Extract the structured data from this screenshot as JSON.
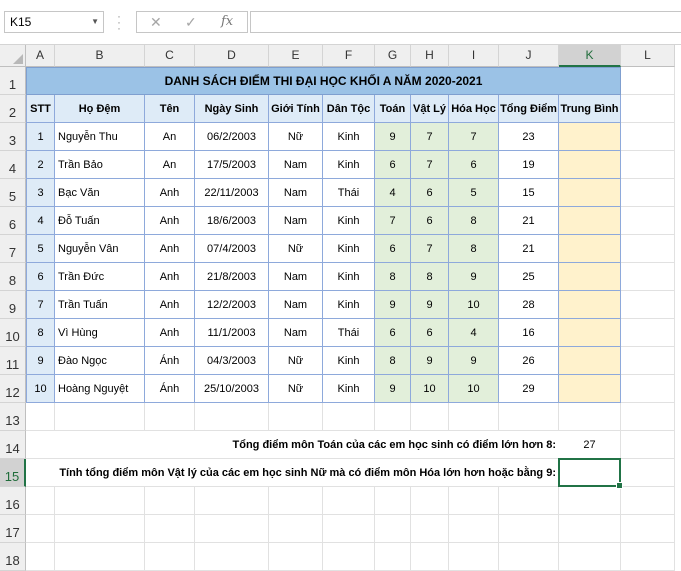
{
  "formula_bar": {
    "name_box": "K15",
    "cancel_icon": "✕",
    "enter_icon": "✓",
    "fx_label": "fx",
    "formula": ""
  },
  "columns": [
    "A",
    "B",
    "C",
    "D",
    "E",
    "F",
    "G",
    "H",
    "I",
    "J",
    "K",
    "L"
  ],
  "rows": [
    "1",
    "2",
    "3",
    "4",
    "5",
    "6",
    "7",
    "8",
    "9",
    "10",
    "11",
    "12",
    "13",
    "14",
    "15",
    "16",
    "17",
    "18"
  ],
  "sheet": {
    "title": "DANH SÁCH ĐIỂM THI ĐẠI HỌC KHỐI A NĂM 2020-2021",
    "headers": [
      "STT",
      "Họ Đệm",
      "Tên",
      "Ngày Sinh",
      "Giới Tính",
      "Dân Tộc",
      "Toán",
      "Vật Lý",
      "Hóa Học",
      "Tổng Điểm",
      "Trung Bình"
    ],
    "records": [
      [
        "1",
        "Nguyễn Thu",
        "An",
        "06/2/2003",
        "Nữ",
        "Kinh",
        "9",
        "7",
        "7",
        "23",
        ""
      ],
      [
        "2",
        "Trần Bảo",
        "An",
        "17/5/2003",
        "Nam",
        "Kinh",
        "6",
        "7",
        "6",
        "19",
        ""
      ],
      [
        "3",
        "Bạc Văn",
        "Anh",
        "22/11/2003",
        "Nam",
        "Thái",
        "4",
        "6",
        "5",
        "15",
        ""
      ],
      [
        "4",
        "Đỗ Tuấn",
        "Anh",
        "18/6/2003",
        "Nam",
        "Kinh",
        "7",
        "6",
        "8",
        "21",
        ""
      ],
      [
        "5",
        "Nguyễn Vân",
        "Anh",
        "07/4/2003",
        "Nữ",
        "Kinh",
        "6",
        "7",
        "8",
        "21",
        ""
      ],
      [
        "6",
        "Trần Đức",
        "Anh",
        "21/8/2003",
        "Nam",
        "Kinh",
        "8",
        "8",
        "9",
        "25",
        ""
      ],
      [
        "7",
        "Trần Tuấn",
        "Anh",
        "12/2/2003",
        "Nam",
        "Kinh",
        "9",
        "9",
        "10",
        "28",
        ""
      ],
      [
        "8",
        "Vì Hùng",
        "Anh",
        "11/1/2003",
        "Nam",
        "Thái",
        "6",
        "6",
        "4",
        "16",
        ""
      ],
      [
        "9",
        "Đào Ngọc",
        "Ánh",
        "04/3/2003",
        "Nữ",
        "Kinh",
        "8",
        "9",
        "9",
        "26",
        ""
      ],
      [
        "10",
        "Hoàng Nguyệt",
        "Ánh",
        "25/10/2003",
        "Nữ",
        "Kinh",
        "9",
        "10",
        "10",
        "29",
        ""
      ]
    ],
    "q1_label": "Tổng điểm môn Toán của các em học sinh có điểm lớn hơn 8:",
    "q1_value": "27",
    "q2_label": "Tính tổng điểm môn Vật lý của các em học sinh Nữ mà có điểm môn Hóa lớn hơn hoặc bằng 9:",
    "q2_value": ""
  },
  "selected_cell": "K15",
  "colors": {
    "title_fill": "#9bc2e6",
    "header_fill": "#deebf7",
    "score_fill": "#e2efda",
    "average_fill": "#fff2cc",
    "selection": "#217346"
  }
}
